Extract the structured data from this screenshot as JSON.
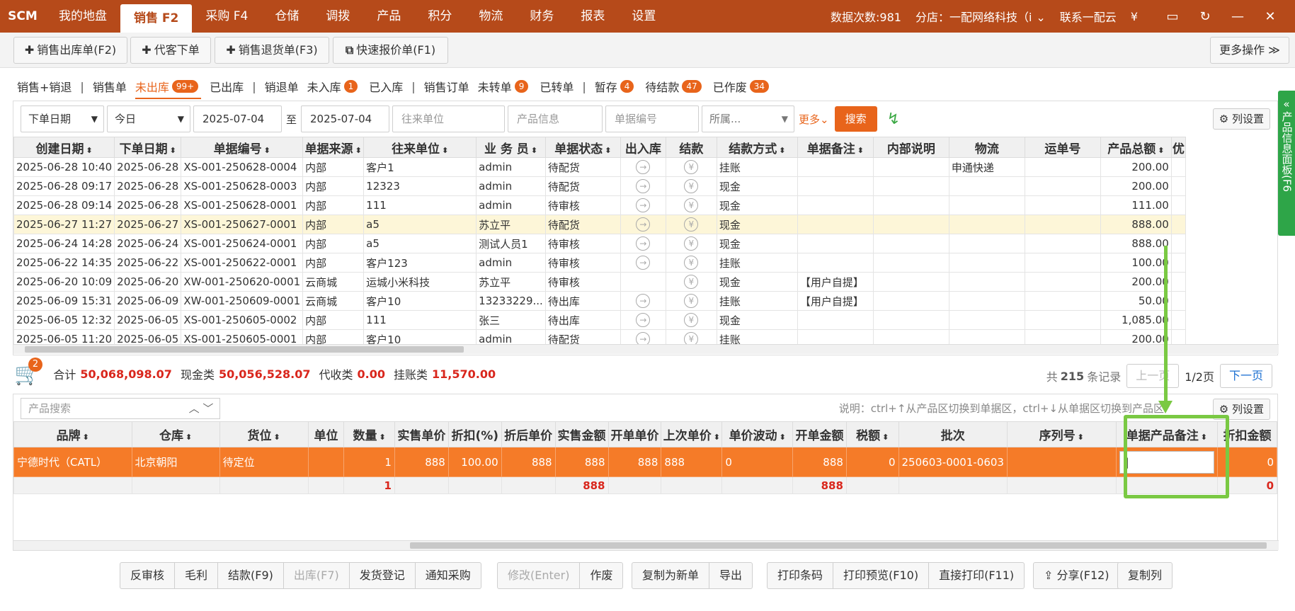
{
  "topnav": {
    "logo": "SCM",
    "items": [
      "我的地盘",
      "销售 F2",
      "采购 F4",
      "仓储",
      "调拨",
      "产品",
      "积分",
      "物流",
      "财务",
      "报表",
      "设置"
    ],
    "data_count": "数据次数:981",
    "branch": "分店：一配网络科技（i",
    "contact": "联系一配云",
    "currency": "¥"
  },
  "toolbar": {
    "buttons": [
      "销售出库单(F2)",
      "代客下单",
      "销售退货单(F3)",
      "快速报价单(F1)"
    ],
    "more": "更多操作"
  },
  "tabs": {
    "t1": "销售+销退",
    "t2": "销售单",
    "t3": "未出库",
    "t3_badge": "99+",
    "t4": "已出库",
    "t5": "销退单",
    "t6": "未入库",
    "t6_badge": "1",
    "t7": "已入库",
    "t8": "销售订单",
    "t9": "未转单",
    "t9_badge": "9",
    "t10": "已转单",
    "t11": "暂存",
    "t11_badge": "4",
    "t12": "待结款",
    "t12_badge": "47",
    "t13": "已作废",
    "t13_badge": "34"
  },
  "search": {
    "date_type": "下单日期",
    "period": "今日",
    "date_from": "2025-07-04",
    "to": "至",
    "date_to": "2025-07-04",
    "partner_ph": "往来单位",
    "product_ph": "产品信息",
    "docno_ph": "单据编号",
    "belong": "所属...",
    "more": "更多",
    "search_btn": "搜索",
    "colset": "列设置"
  },
  "orders": {
    "headers": [
      "创建日期",
      "下单日期",
      "单据编号",
      "单据来源",
      "往来单位",
      "业 务 员",
      "单据状态",
      "出入库",
      "结款",
      "结款方式",
      "单据备注",
      "内部说明",
      "物流",
      "运单号",
      "产品总额",
      "优"
    ],
    "rows": [
      [
        "2025-06-28 10:40",
        "2025-06-28",
        "XS-001-250628-0004",
        "内部",
        "客户1",
        "admin",
        "待配货",
        "→",
        "¥",
        "挂账",
        "",
        "",
        "申通快递",
        "",
        "200.00"
      ],
      [
        "2025-06-28 09:17",
        "2025-06-28",
        "XS-001-250628-0003",
        "内部",
        "12323",
        "admin",
        "待配货",
        "→",
        "¥",
        "现金",
        "",
        "",
        "",
        "",
        "200.00"
      ],
      [
        "2025-06-28 09:14",
        "2025-06-28",
        "XS-001-250628-0001",
        "内部",
        "111",
        "admin",
        "待审核",
        "→",
        "¥",
        "现金",
        "",
        "",
        "",
        "",
        "111.00"
      ],
      [
        "2025-06-27 11:27",
        "2025-06-27",
        "XS-001-250627-0001",
        "内部",
        "a5",
        "苏立平",
        "待配货",
        "→",
        "¥",
        "现金",
        "",
        "",
        "",
        "",
        "888.00"
      ],
      [
        "2025-06-24 14:28",
        "2025-06-24",
        "XS-001-250624-0001",
        "内部",
        "a5",
        "测试人员1",
        "待审核",
        "→",
        "¥",
        "现金",
        "",
        "",
        "",
        "",
        "888.00"
      ],
      [
        "2025-06-22 14:35",
        "2025-06-22",
        "XS-001-250622-0001",
        "内部",
        "客户123",
        "admin",
        "待审核",
        "→",
        "¥",
        "挂账",
        "",
        "",
        "",
        "",
        "100.00"
      ],
      [
        "2025-06-20 10:09",
        "2025-06-20",
        "XW-001-250620-0001",
        "云商城",
        "运城小米科技",
        "苏立平",
        "待审核",
        "",
        "¥",
        "现金",
        "【用户自提】",
        "",
        "",
        "",
        "200.00"
      ],
      [
        "2025-06-09 15:31",
        "2025-06-09",
        "XW-001-250609-0001",
        "云商城",
        "客户10",
        "13233229...",
        "待出库",
        "→",
        "¥",
        "挂账",
        "【用户自提】",
        "",
        "",
        "",
        "50.00"
      ],
      [
        "2025-06-05 12:32",
        "2025-06-05",
        "XS-001-250605-0002",
        "内部",
        "111",
        "张三",
        "待出库",
        "→",
        "¥",
        "现金",
        "",
        "",
        "",
        "",
        "1,085.00"
      ],
      [
        "2025-06-05 11:20",
        "2025-06-05",
        "XS-001-250605-0001",
        "内部",
        "客户10",
        "admin",
        "待配货",
        "→",
        "¥",
        "挂账",
        "",
        "",
        "",
        "",
        "200.00"
      ]
    ]
  },
  "summary": {
    "cart_count": "2",
    "total_label": "合计",
    "total": "50,068,098.07",
    "cash_label": "现金类",
    "cash": "50,056,528.07",
    "collect_label": "代收类",
    "collect": "0.00",
    "credit_label": "挂账类",
    "credit": "11,570.00"
  },
  "pager": {
    "prefix": "共",
    "count": "215",
    "suffix": "条记录",
    "prev": "上一页",
    "page": "1/2页",
    "next": "下一页"
  },
  "products": {
    "search_ph": "产品搜索",
    "hint": "说明：ctrl+↑从产品区切换到单据区，ctrl+↓从单据区切换到产品区",
    "colset": "列设置",
    "headers": [
      "品牌",
      "仓库",
      "货位",
      "单位",
      "数量",
      "实售单价",
      "折扣(%)",
      "折后单价",
      "实售金额",
      "开单单价",
      "上次单价",
      "单价波动",
      "开单金额",
      "税额",
      "批次",
      "序列号",
      "单据产品备注",
      "折扣金额"
    ],
    "row": [
      "宁德时代（CATL）",
      "北京朝阳",
      "待定位",
      "",
      "1",
      "888",
      "100.00",
      "888",
      "888",
      "888",
      "888",
      "0",
      "888",
      "0",
      "250603-0001-0603",
      "",
      "",
      "0"
    ],
    "totals": {
      "qty": "1",
      "amount": "888",
      "open_amount": "888",
      "discount": "0"
    }
  },
  "actions": {
    "g1": [
      "反审核",
      "毛利",
      "结款(F9)",
      "出库(F7)",
      "发货登记",
      "通知采购"
    ],
    "g2": [
      "修改(Enter)",
      "作废"
    ],
    "g3": [
      "复制为新单",
      "导出"
    ],
    "g4": [
      "打印条码",
      "打印预览(F10)",
      "直接打印(F11)"
    ],
    "share": "分享(F12)",
    "copy_col": "复制列"
  },
  "side_panel": "产品信息面板(F6",
  "colors": {
    "brand": "#b64a1a",
    "accent": "#e8641b",
    "highlight": "#7ac943"
  }
}
